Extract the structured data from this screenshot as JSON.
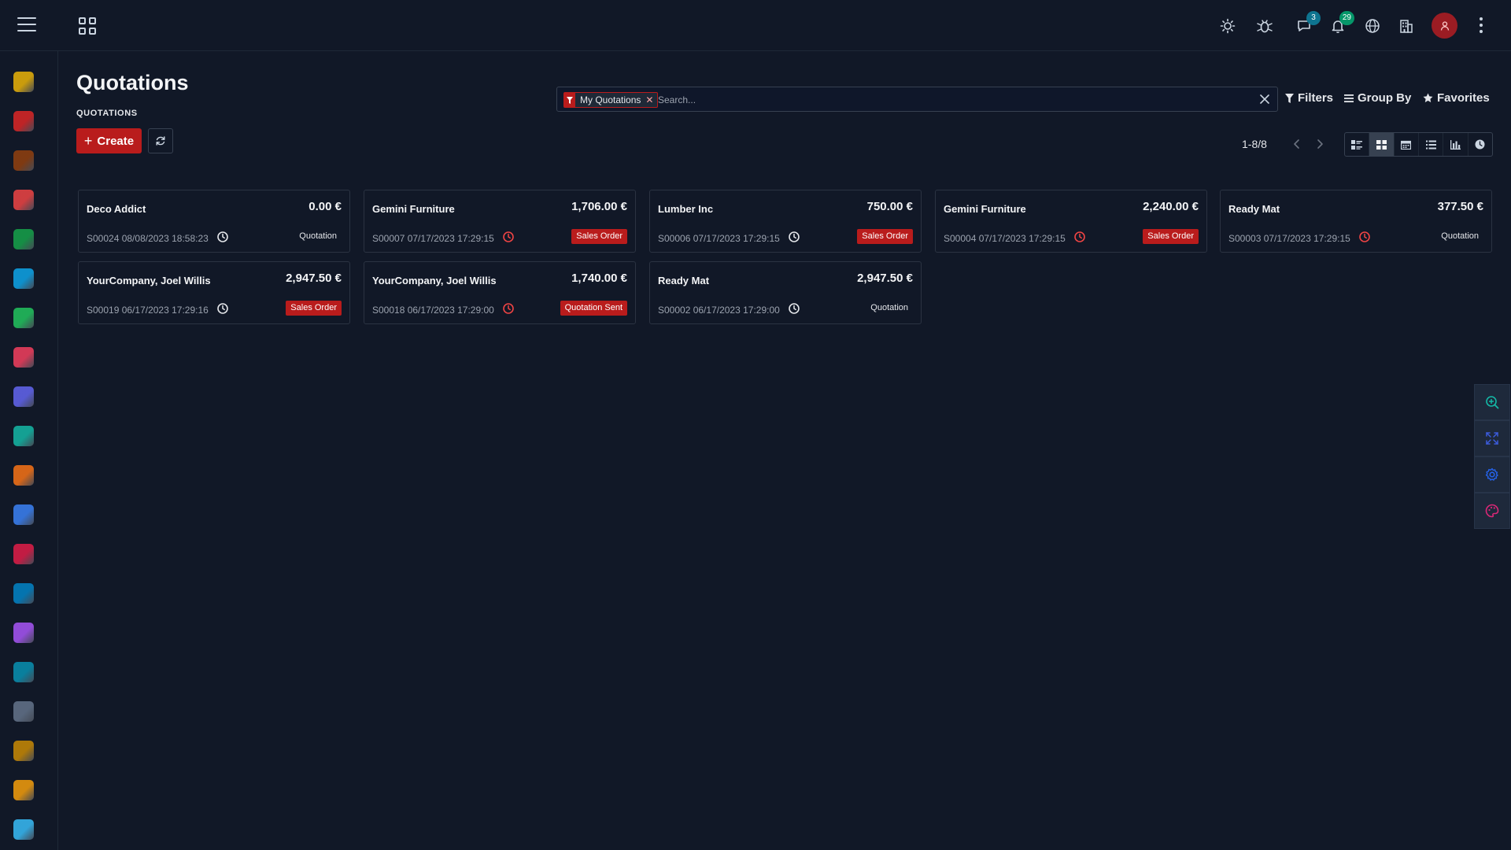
{
  "page": {
    "title": "Quotations",
    "breadcrumb": "QUOTATIONS"
  },
  "toolbar": {
    "create_label": "Create"
  },
  "search": {
    "facet_label": "My Quotations",
    "placeholder": "Search...",
    "filters_label": "Filters",
    "groupby_label": "Group By",
    "favorites_label": "Favorites"
  },
  "pager": {
    "value": "1-8/8"
  },
  "topbar": {
    "messages_badge": "3",
    "activities_badge": "29",
    "colors": {
      "accent": "#b91c1c",
      "badge_teal": "#0e7490",
      "badge_green": "#059669"
    }
  },
  "sidebar": {
    "items": [
      {
        "icon": "discuss-icon",
        "color": "#eab308"
      },
      {
        "icon": "calendar-icon",
        "color": "#dc2626"
      },
      {
        "icon": "contacts-icon",
        "color": "#92400e"
      },
      {
        "icon": "crm-icon",
        "color": "#ef4444"
      },
      {
        "icon": "sales-icon",
        "color": "#16a34a"
      },
      {
        "icon": "dashboard-icon",
        "color": "#0ea5e9"
      },
      {
        "icon": "invoicing-icon",
        "color": "#22c55e"
      },
      {
        "icon": "project-icon",
        "color": "#f43f5e"
      },
      {
        "icon": "timesheet-icon",
        "color": "#6366f1"
      },
      {
        "icon": "purchase-icon",
        "color": "#14b8a6"
      },
      {
        "icon": "inventory-icon",
        "color": "#f97316"
      },
      {
        "icon": "manufacturing-icon",
        "color": "#3b82f6"
      },
      {
        "icon": "repair-icon",
        "color": "#e11d48"
      },
      {
        "icon": "maintenance-icon",
        "color": "#0284c7"
      },
      {
        "icon": "employees-icon",
        "color": "#a855f7"
      },
      {
        "icon": "fleet-icon",
        "color": "#0891b2"
      },
      {
        "icon": "recruitment-icon",
        "color": "#64748b"
      },
      {
        "icon": "expenses-icon",
        "color": "#ca8a04"
      },
      {
        "icon": "appraisal-icon",
        "color": "#f59e0b"
      },
      {
        "icon": "live-chat-icon",
        "color": "#38bdf8"
      }
    ]
  },
  "cards": [
    {
      "name": "Deco Addict",
      "amount": "0.00 €",
      "ref": "S00024 08/08/2023 18:58:23",
      "state": "Quotation",
      "state_style": "plain",
      "clock": "neutral"
    },
    {
      "name": "Gemini Furniture",
      "amount": "1,706.00 €",
      "ref": "S00007 07/17/2023 17:29:15",
      "state": "Sales Order",
      "state_style": "red",
      "clock": "overdue"
    },
    {
      "name": "Lumber Inc",
      "amount": "750.00 €",
      "ref": "S00006 07/17/2023 17:29:15",
      "state": "Sales Order",
      "state_style": "red",
      "clock": "neutral"
    },
    {
      "name": "Gemini Furniture",
      "amount": "2,240.00 €",
      "ref": "S00004 07/17/2023 17:29:15",
      "state": "Sales Order",
      "state_style": "red",
      "clock": "overdue"
    },
    {
      "name": "Ready Mat",
      "amount": "377.50 €",
      "ref": "S00003 07/17/2023 17:29:15",
      "state": "Quotation",
      "state_style": "plain",
      "clock": "overdue"
    },
    {
      "name": "YourCompany, Joel Willis",
      "amount": "2,947.50 €",
      "ref": "S00019 06/17/2023 17:29:16",
      "state": "Sales Order",
      "state_style": "red",
      "clock": "neutral"
    },
    {
      "name": "YourCompany, Joel Willis",
      "amount": "1,740.00 €",
      "ref": "S00018 06/17/2023 17:29:00",
      "state": "Quotation Sent",
      "state_style": "red",
      "clock": "overdue"
    },
    {
      "name": "Ready Mat",
      "amount": "2,947.50 €",
      "ref": "S00002 06/17/2023 17:29:00",
      "state": "Quotation",
      "state_style": "plain",
      "clock": "neutral"
    }
  ]
}
